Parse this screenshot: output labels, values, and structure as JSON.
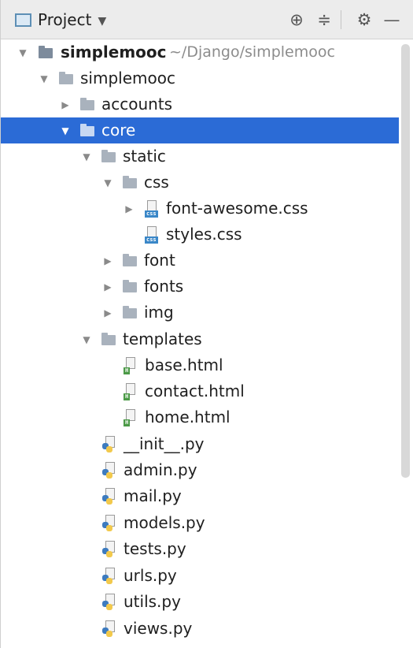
{
  "header": {
    "title": "Project",
    "icons": [
      "dropdown-caret-icon",
      "locate-icon",
      "collapse-all-icon",
      "gear-icon",
      "hide-icon"
    ]
  },
  "colors": {
    "selection": "#2b6bd6",
    "folder": "#a9b2bd",
    "css_badge": "#3a87c8",
    "html_badge": "#4b9a47",
    "python_blue": "#3d7bbf",
    "python_yellow": "#f2c94c"
  },
  "tree": {
    "rows": [
      {
        "name": "simplemooc",
        "path": "~/Django/simplemooc",
        "expanded": true
      },
      {
        "name": "simplemooc",
        "expanded": true
      },
      {
        "name": "accounts",
        "expanded": false
      },
      {
        "name": "core",
        "expanded": true,
        "selected": true
      },
      {
        "name": "static",
        "expanded": true
      },
      {
        "name": "css",
        "expanded": true
      },
      {
        "name": "font-awesome.css",
        "expanded": false
      },
      {
        "name": "styles.css"
      },
      {
        "name": "font",
        "expanded": false
      },
      {
        "name": "fonts",
        "expanded": false
      },
      {
        "name": "img",
        "expanded": false
      },
      {
        "name": "templates",
        "expanded": true
      },
      {
        "name": "base.html"
      },
      {
        "name": "contact.html"
      },
      {
        "name": "home.html"
      },
      {
        "name": "__init__.py"
      },
      {
        "name": "admin.py"
      },
      {
        "name": "mail.py"
      },
      {
        "name": "models.py"
      },
      {
        "name": "tests.py"
      },
      {
        "name": "urls.py"
      },
      {
        "name": "utils.py"
      },
      {
        "name": "views.py"
      }
    ]
  }
}
